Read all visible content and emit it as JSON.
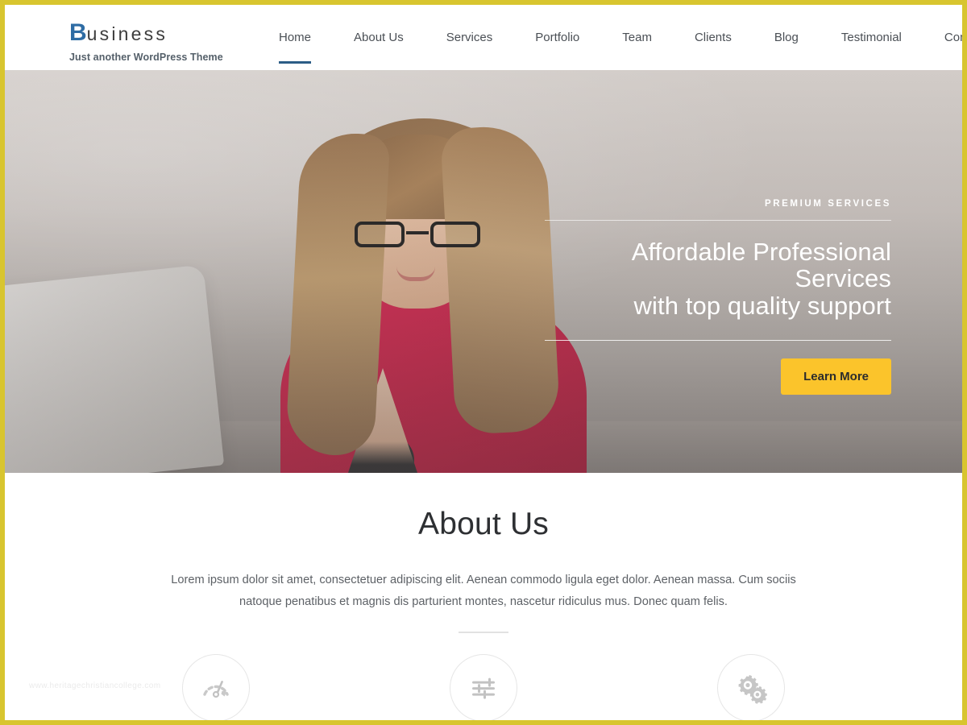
{
  "theme": {
    "frame_color": "#d8c52f",
    "brand_blue": "#2e6ca4",
    "accent_yellow": "#fbc42b",
    "active_dot_blue": "#2196f3",
    "nav_active_underline": "#2c5d86"
  },
  "header": {
    "brand": {
      "initial": "B",
      "rest": "usiness",
      "tagline": "Just another WordPress Theme"
    },
    "nav": [
      {
        "label": "Home",
        "active": true
      },
      {
        "label": "About Us",
        "active": false
      },
      {
        "label": "Services",
        "active": false
      },
      {
        "label": "Portfolio",
        "active": false
      },
      {
        "label": "Team",
        "active": false
      },
      {
        "label": "Clients",
        "active": false
      },
      {
        "label": "Blog",
        "active": false
      },
      {
        "label": "Testimonial",
        "active": false
      },
      {
        "label": "Contact",
        "active": false
      }
    ]
  },
  "hero": {
    "eyebrow": "PREMIUM SERVICES",
    "title_line1": "Affordable Professional Services",
    "title_line2": "with top quality support",
    "cta_label": "Learn More",
    "slides": [
      {
        "index": 1,
        "active": true
      },
      {
        "index": 2,
        "active": false
      },
      {
        "index": 3,
        "active": false
      },
      {
        "index": 4,
        "active": false
      }
    ]
  },
  "about": {
    "title": "About Us",
    "paragraph": "Lorem ipsum dolor sit amet, consectetuer adipiscing elit. Aenean commodo ligula eget dolor. Aenean massa. Cum sociis natoque penatibus et magnis dis parturient montes, nascetur ridiculus mus. Donec quam felis.",
    "features": [
      {
        "icon": "speedometer-icon"
      },
      {
        "icon": "sliders-icon"
      },
      {
        "icon": "gears-icon"
      }
    ]
  },
  "watermark": {
    "text": "www.heritagechristiancollege.com"
  }
}
